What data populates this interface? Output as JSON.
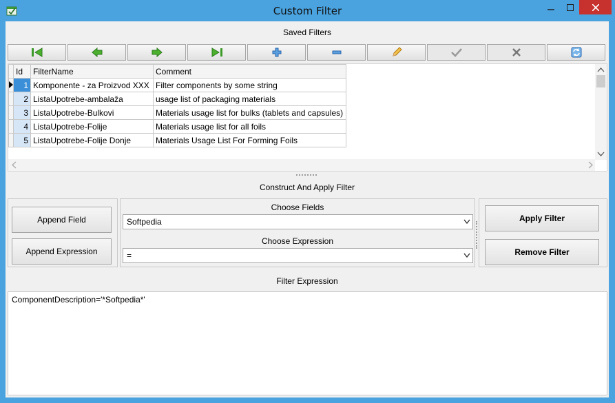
{
  "window": {
    "title": "Custom Filter",
    "minimize_label": "−",
    "maximize_label": "□",
    "close_label": "✕"
  },
  "saved_filters": {
    "header": "Saved Filters",
    "toolbar": [
      {
        "name": "first-record-button",
        "icon": "first-icon",
        "enabled": true
      },
      {
        "name": "previous-record-button",
        "icon": "prev-icon",
        "enabled": true
      },
      {
        "name": "next-record-button",
        "icon": "next-icon",
        "enabled": true
      },
      {
        "name": "last-record-button",
        "icon": "last-icon",
        "enabled": true
      },
      {
        "name": "insert-record-button",
        "icon": "plus-icon",
        "enabled": true
      },
      {
        "name": "delete-record-button",
        "icon": "minus-icon",
        "enabled": true
      },
      {
        "name": "edit-record-button",
        "icon": "pencil-icon",
        "enabled": true
      },
      {
        "name": "post-edit-button",
        "icon": "check-icon",
        "enabled": false
      },
      {
        "name": "cancel-edit-button",
        "icon": "x-icon",
        "enabled": false
      },
      {
        "name": "refresh-button",
        "icon": "refresh-icon",
        "enabled": true
      }
    ],
    "columns": [
      "Id",
      "FilterName",
      "Comment"
    ],
    "rows": [
      {
        "id": "1",
        "name": "Komponente - za Proizvod XXX",
        "comment": "Filter components by some string"
      },
      {
        "id": "2",
        "name": "ListaUpotrebe-ambalaža",
        "comment": "usage list of packaging materials"
      },
      {
        "id": "3",
        "name": "ListaUpotrebe-Bulkovi",
        "comment": "Materials usage list for bulks (tablets and capsules)"
      },
      {
        "id": "4",
        "name": "ListaUpotrebe-Folije",
        "comment": "Materials usage list for all foils"
      },
      {
        "id": "5",
        "name": "ListaUpotrebe-Folije Donje",
        "comment": "Materials Usage List For Forming Foils"
      }
    ]
  },
  "construct": {
    "header": "Construct And Apply Filter",
    "append_field_label": "Append Field",
    "append_expression_label": "Append Expression",
    "choose_fields_label": "Choose Fields",
    "field_value": "Softpedia",
    "choose_expression_label": "Choose Expression",
    "expression_value": "=",
    "apply_label": "Apply Filter",
    "remove_label": "Remove Filter"
  },
  "filter_expression": {
    "header": "Filter Expression",
    "text": "ComponentDescription='*Softpedia*'"
  },
  "colors": {
    "titlebar": "#4aa3df",
    "close": "#c7312e",
    "selected_id": "#3b8fd9"
  }
}
